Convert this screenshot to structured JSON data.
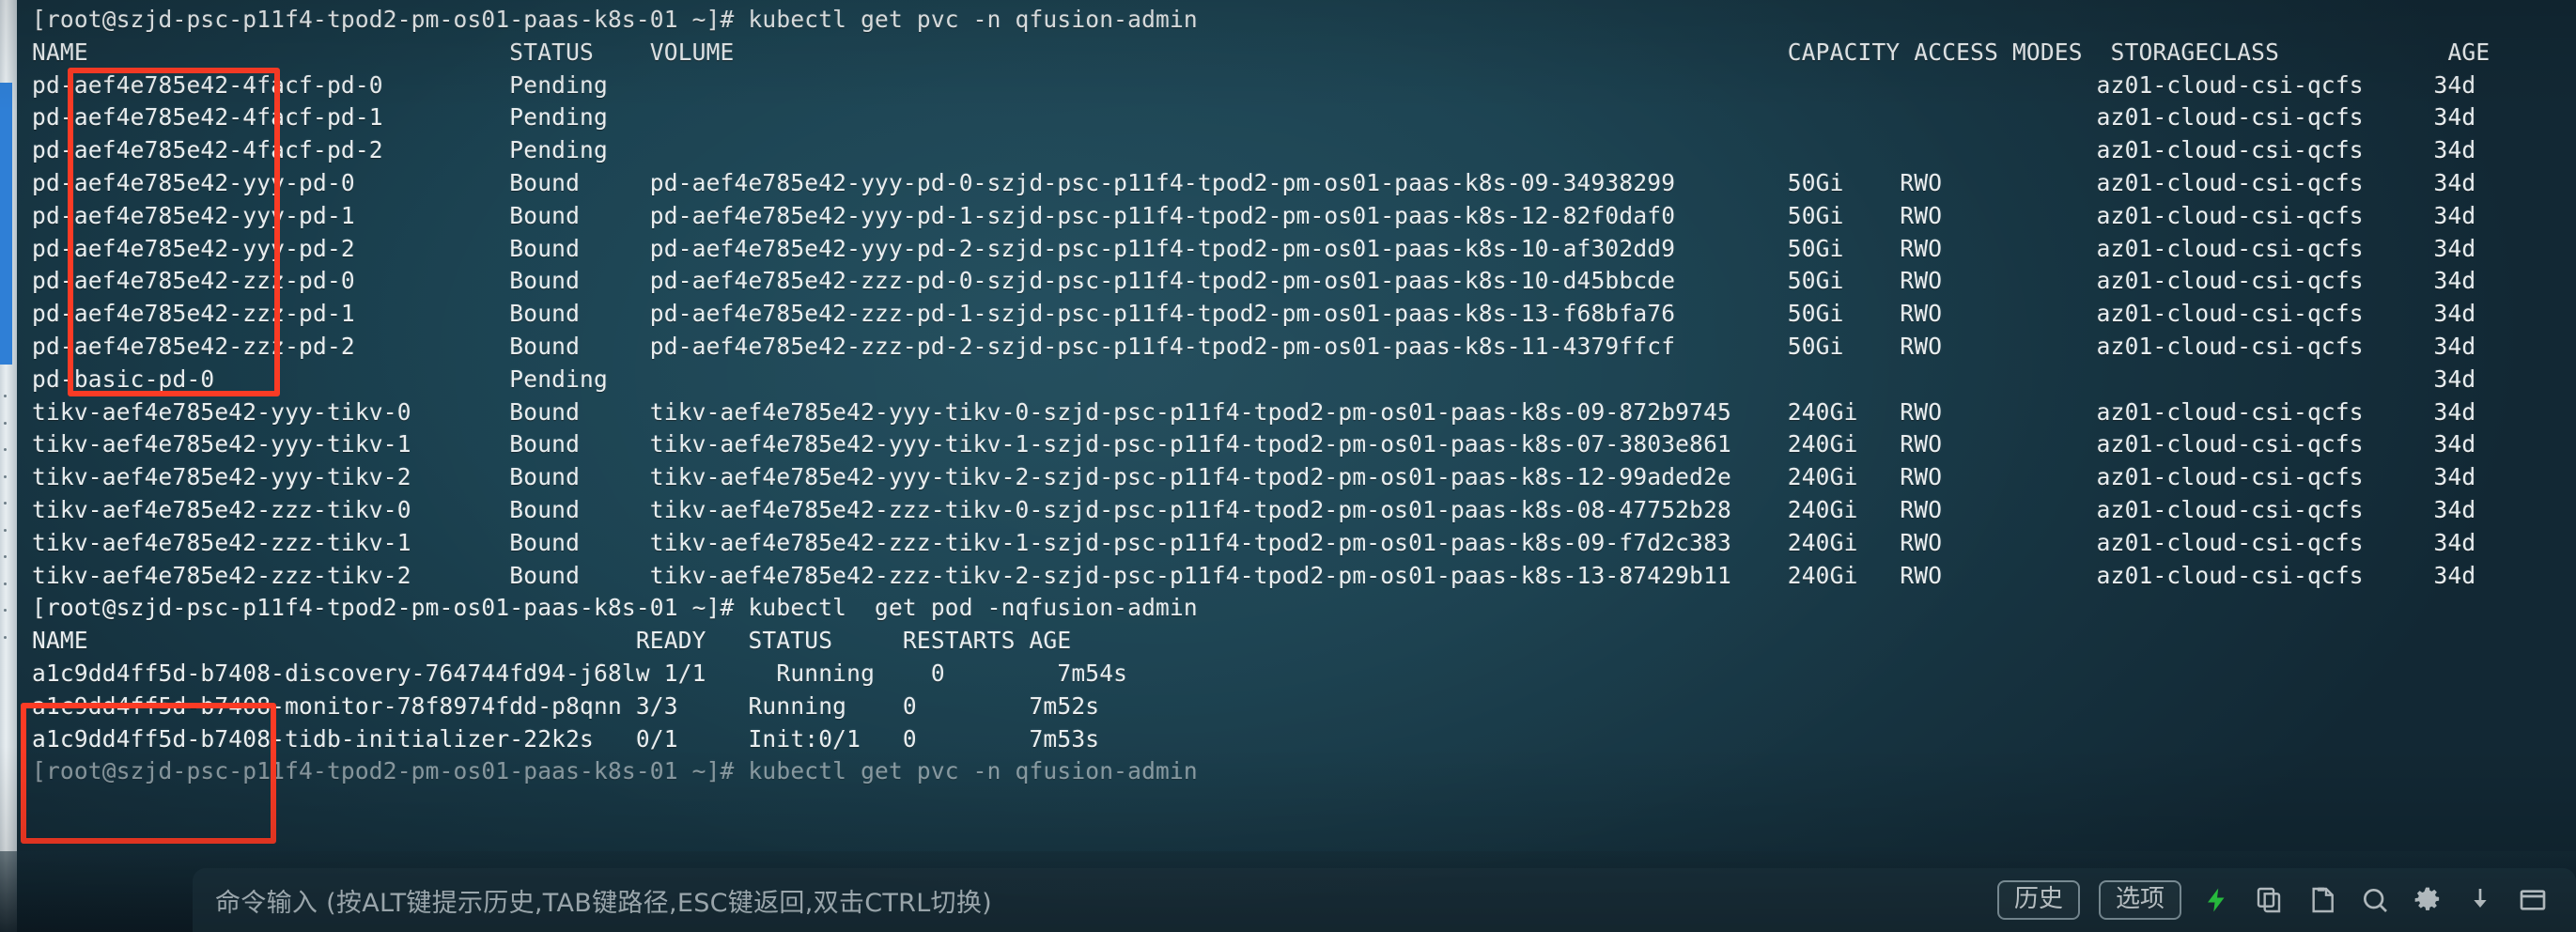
{
  "terminal": {
    "pvc_command_line": "[root@szjd-psc-p11f4-tpod2-pm-os01-paas-k8s-01 ~]# kubectl get pvc -n qfusion-admin",
    "pvc_headers": {
      "name": "NAME",
      "status": "STATUS",
      "volume": "VOLUME",
      "capacity": "CAPACITY",
      "access_modes": "ACCESS MODES",
      "storageclass": "STORAGECLASS",
      "age": "AGE"
    },
    "pvc_rows": [
      {
        "name": "pd-aef4e785e42-4facf-pd-0",
        "status": "Pending",
        "volume": "",
        "capacity": "",
        "access_modes": "",
        "storageclass": "az01-cloud-csi-qcfs",
        "age": "34d"
      },
      {
        "name": "pd-aef4e785e42-4facf-pd-1",
        "status": "Pending",
        "volume": "",
        "capacity": "",
        "access_modes": "",
        "storageclass": "az01-cloud-csi-qcfs",
        "age": "34d"
      },
      {
        "name": "pd-aef4e785e42-4facf-pd-2",
        "status": "Pending",
        "volume": "",
        "capacity": "",
        "access_modes": "",
        "storageclass": "az01-cloud-csi-qcfs",
        "age": "34d"
      },
      {
        "name": "pd-aef4e785e42-yyy-pd-0",
        "status": "Bound",
        "volume": "pd-aef4e785e42-yyy-pd-0-szjd-psc-p11f4-tpod2-pm-os01-paas-k8s-09-34938299",
        "capacity": "50Gi",
        "access_modes": "RWO",
        "storageclass": "az01-cloud-csi-qcfs",
        "age": "34d"
      },
      {
        "name": "pd-aef4e785e42-yyy-pd-1",
        "status": "Bound",
        "volume": "pd-aef4e785e42-yyy-pd-1-szjd-psc-p11f4-tpod2-pm-os01-paas-k8s-12-82f0daf0",
        "capacity": "50Gi",
        "access_modes": "RWO",
        "storageclass": "az01-cloud-csi-qcfs",
        "age": "34d"
      },
      {
        "name": "pd-aef4e785e42-yyy-pd-2",
        "status": "Bound",
        "volume": "pd-aef4e785e42-yyy-pd-2-szjd-psc-p11f4-tpod2-pm-os01-paas-k8s-10-af302dd9",
        "capacity": "50Gi",
        "access_modes": "RWO",
        "storageclass": "az01-cloud-csi-qcfs",
        "age": "34d"
      },
      {
        "name": "pd-aef4e785e42-zzz-pd-0",
        "status": "Bound",
        "volume": "pd-aef4e785e42-zzz-pd-0-szjd-psc-p11f4-tpod2-pm-os01-paas-k8s-10-d45bbcde",
        "capacity": "50Gi",
        "access_modes": "RWO",
        "storageclass": "az01-cloud-csi-qcfs",
        "age": "34d"
      },
      {
        "name": "pd-aef4e785e42-zzz-pd-1",
        "status": "Bound",
        "volume": "pd-aef4e785e42-zzz-pd-1-szjd-psc-p11f4-tpod2-pm-os01-paas-k8s-13-f68bfa76",
        "capacity": "50Gi",
        "access_modes": "RWO",
        "storageclass": "az01-cloud-csi-qcfs",
        "age": "34d"
      },
      {
        "name": "pd-aef4e785e42-zzz-pd-2",
        "status": "Bound",
        "volume": "pd-aef4e785e42-zzz-pd-2-szjd-psc-p11f4-tpod2-pm-os01-paas-k8s-11-4379ffcf",
        "capacity": "50Gi",
        "access_modes": "RWO",
        "storageclass": "az01-cloud-csi-qcfs",
        "age": "34d"
      },
      {
        "name": "pd-basic-pd-0",
        "status": "Pending",
        "volume": "",
        "capacity": "",
        "access_modes": "",
        "storageclass": "",
        "age": "34d"
      },
      {
        "name": "tikv-aef4e785e42-yyy-tikv-0",
        "status": "Bound",
        "volume": "tikv-aef4e785e42-yyy-tikv-0-szjd-psc-p11f4-tpod2-pm-os01-paas-k8s-09-872b9745",
        "capacity": "240Gi",
        "access_modes": "RWO",
        "storageclass": "az01-cloud-csi-qcfs",
        "age": "34d"
      },
      {
        "name": "tikv-aef4e785e42-yyy-tikv-1",
        "status": "Bound",
        "volume": "tikv-aef4e785e42-yyy-tikv-1-szjd-psc-p11f4-tpod2-pm-os01-paas-k8s-07-3803e861",
        "capacity": "240Gi",
        "access_modes": "RWO",
        "storageclass": "az01-cloud-csi-qcfs",
        "age": "34d"
      },
      {
        "name": "tikv-aef4e785e42-yyy-tikv-2",
        "status": "Bound",
        "volume": "tikv-aef4e785e42-yyy-tikv-2-szjd-psc-p11f4-tpod2-pm-os01-paas-k8s-12-99aded2e",
        "capacity": "240Gi",
        "access_modes": "RWO",
        "storageclass": "az01-cloud-csi-qcfs",
        "age": "34d"
      },
      {
        "name": "tikv-aef4e785e42-zzz-tikv-0",
        "status": "Bound",
        "volume": "tikv-aef4e785e42-zzz-tikv-0-szjd-psc-p11f4-tpod2-pm-os01-paas-k8s-08-47752b28",
        "capacity": "240Gi",
        "access_modes": "RWO",
        "storageclass": "az01-cloud-csi-qcfs",
        "age": "34d"
      },
      {
        "name": "tikv-aef4e785e42-zzz-tikv-1",
        "status": "Bound",
        "volume": "tikv-aef4e785e42-zzz-tikv-1-szjd-psc-p11f4-tpod2-pm-os01-paas-k8s-09-f7d2c383",
        "capacity": "240Gi",
        "access_modes": "RWO",
        "storageclass": "az01-cloud-csi-qcfs",
        "age": "34d"
      },
      {
        "name": "tikv-aef4e785e42-zzz-tikv-2",
        "status": "Bound",
        "volume": "tikv-aef4e785e42-zzz-tikv-2-szjd-psc-p11f4-tpod2-pm-os01-paas-k8s-13-87429b11",
        "capacity": "240Gi",
        "access_modes": "RWO",
        "storageclass": "az01-cloud-csi-qcfs",
        "age": "34d"
      }
    ],
    "pod_command_line": "[root@szjd-psc-p11f4-tpod2-pm-os01-paas-k8s-01 ~]# kubectl  get pod -nqfusion-admin",
    "pod_headers": {
      "name": "NAME",
      "ready": "READY",
      "status": "STATUS",
      "restarts": "RESTARTS",
      "age": "AGE"
    },
    "pod_rows": [
      {
        "name": "a1c9dd4ff5d-b7408-discovery-764744fd94-j68lw",
        "ready": "1/1",
        "status": "Running",
        "restarts": "0",
        "age": "7m54s"
      },
      {
        "name": "a1c9dd4ff5d-b7408-monitor-78f8974fdd-p8qnn",
        "ready": "3/3",
        "status": "Running",
        "restarts": "0",
        "age": "7m52s"
      },
      {
        "name": "a1c9dd4ff5d-b7408-tidb-initializer-22k2s",
        "ready": "0/1",
        "status": "Init:0/1",
        "restarts": "0",
        "age": "7m53s"
      }
    ],
    "last_command_line": "[root@szjd-psc-p11f4-tpod2-pm-os01-paas-k8s-01 ~]# kubectl get pvc -n qfusion-admin"
  },
  "annotations": {
    "color": "#fb3b25",
    "pvc_name_prefix_box_label": "aef4e785e42 prefix highlight",
    "pod_name_prefix_box_label": "a1c9dd4ff5d-b7408 prefix highlight"
  },
  "command_bar": {
    "placeholder": "命令输入 (按ALT键提示历史,TAB键路径,ESC键返回,双击CTRL切换)",
    "history_label": "历史",
    "options_label": "选项",
    "icons": [
      "lightning-icon",
      "copy-icon",
      "paste-icon",
      "search-icon",
      "gear-icon",
      "download-icon",
      "window-icon"
    ],
    "bolt_color": "#2fe24a"
  }
}
